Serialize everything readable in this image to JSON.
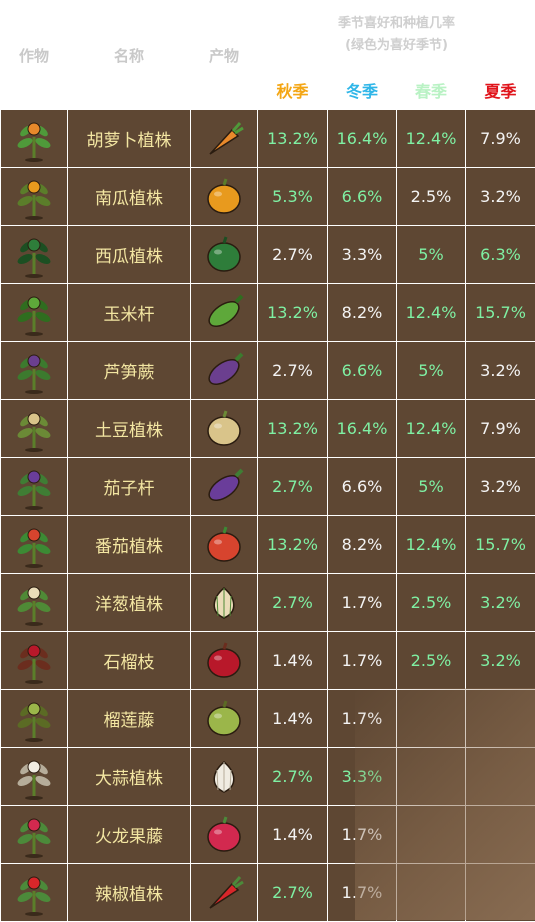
{
  "header": {
    "col_crop": "作物",
    "col_name": "名称",
    "col_product": "产物",
    "note_line1": "季节喜好和种植几率",
    "note_line2": "(绿色为喜好季节)",
    "seasons": [
      "秋季",
      "冬季",
      "春季",
      "夏季"
    ]
  },
  "colors": {
    "background": "#5e4733",
    "name_text": "#f3e6a2",
    "favored_value": "#7ff0a3",
    "normal_value": "#f4f4f4",
    "autumn": "#f4a614",
    "winter": "#2fb6e8",
    "spring": "#b9f2c4",
    "summer": "#e0141b"
  },
  "rows": [
    {
      "name": "胡萝卜植株",
      "crop_icon": "carrot-plant-icon",
      "product_icon": "carrot-icon",
      "values": [
        {
          "v": "13.2%",
          "fav": true
        },
        {
          "v": "16.4%",
          "fav": true
        },
        {
          "v": "12.4%",
          "fav": true
        },
        {
          "v": "7.9%",
          "fav": false
        }
      ]
    },
    {
      "name": "南瓜植株",
      "crop_icon": "pumpkin-plant-icon",
      "product_icon": "pumpkin-icon",
      "values": [
        {
          "v": "5.3%",
          "fav": true
        },
        {
          "v": "6.6%",
          "fav": true
        },
        {
          "v": "2.5%",
          "fav": false
        },
        {
          "v": "3.2%",
          "fav": false
        }
      ]
    },
    {
      "name": "西瓜植株",
      "crop_icon": "watermelon-plant-icon",
      "product_icon": "watermelon-icon",
      "values": [
        {
          "v": "2.7%",
          "fav": false
        },
        {
          "v": "3.3%",
          "fav": false
        },
        {
          "v": "5%",
          "fav": true
        },
        {
          "v": "6.3%",
          "fav": true
        }
      ]
    },
    {
      "name": "玉米杆",
      "crop_icon": "corn-plant-icon",
      "product_icon": "corn-icon",
      "values": [
        {
          "v": "13.2%",
          "fav": true
        },
        {
          "v": "8.2%",
          "fav": false
        },
        {
          "v": "12.4%",
          "fav": true
        },
        {
          "v": "15.7%",
          "fav": true
        }
      ]
    },
    {
      "name": "芦笋蕨",
      "crop_icon": "asparagus-plant-icon",
      "product_icon": "asparagus-icon",
      "values": [
        {
          "v": "2.7%",
          "fav": false
        },
        {
          "v": "6.6%",
          "fav": true
        },
        {
          "v": "5%",
          "fav": true
        },
        {
          "v": "3.2%",
          "fav": false
        }
      ]
    },
    {
      "name": "土豆植株",
      "crop_icon": "potato-plant-icon",
      "product_icon": "potato-icon",
      "values": [
        {
          "v": "13.2%",
          "fav": true
        },
        {
          "v": "16.4%",
          "fav": true
        },
        {
          "v": "12.4%",
          "fav": true
        },
        {
          "v": "7.9%",
          "fav": false
        }
      ]
    },
    {
      "name": "茄子杆",
      "crop_icon": "eggplant-plant-icon",
      "product_icon": "eggplant-icon",
      "values": [
        {
          "v": "2.7%",
          "fav": true
        },
        {
          "v": "6.6%",
          "fav": false
        },
        {
          "v": "5%",
          "fav": true
        },
        {
          "v": "3.2%",
          "fav": false
        }
      ]
    },
    {
      "name": "番茄植株",
      "crop_icon": "tomato-plant-icon",
      "product_icon": "tomato-icon",
      "values": [
        {
          "v": "13.2%",
          "fav": true
        },
        {
          "v": "8.2%",
          "fav": false
        },
        {
          "v": "12.4%",
          "fav": true
        },
        {
          "v": "15.7%",
          "fav": true
        }
      ]
    },
    {
      "name": "洋葱植株",
      "crop_icon": "onion-plant-icon",
      "product_icon": "onion-icon",
      "values": [
        {
          "v": "2.7%",
          "fav": true
        },
        {
          "v": "1.7%",
          "fav": false
        },
        {
          "v": "2.5%",
          "fav": true
        },
        {
          "v": "3.2%",
          "fav": true
        }
      ]
    },
    {
      "name": "石榴枝",
      "crop_icon": "pomegranate-plant-icon",
      "product_icon": "pomegranate-icon",
      "values": [
        {
          "v": "1.4%",
          "fav": false
        },
        {
          "v": "1.7%",
          "fav": false
        },
        {
          "v": "2.5%",
          "fav": true
        },
        {
          "v": "3.2%",
          "fav": true
        }
      ]
    },
    {
      "name": "榴莲藤",
      "crop_icon": "durian-plant-icon",
      "product_icon": "durian-icon",
      "values": [
        {
          "v": "1.4%",
          "fav": false
        },
        {
          "v": "1.7%",
          "fav": false
        },
        {
          "v": "",
          "fav": false
        },
        {
          "v": "",
          "fav": false
        }
      ]
    },
    {
      "name": "大蒜植株",
      "crop_icon": "garlic-plant-icon",
      "product_icon": "garlic-icon",
      "values": [
        {
          "v": "2.7%",
          "fav": true
        },
        {
          "v": "3.3%",
          "fav": true
        },
        {
          "v": "",
          "fav": false
        },
        {
          "v": "",
          "fav": false
        }
      ]
    },
    {
      "name": "火龙果藤",
      "crop_icon": "dragonfruit-plant-icon",
      "product_icon": "dragonfruit-icon",
      "values": [
        {
          "v": "1.4%",
          "fav": false
        },
        {
          "v": "1.7%",
          "fav": false
        },
        {
          "v": "",
          "fav": false
        },
        {
          "v": "",
          "fav": false
        }
      ]
    },
    {
      "name": "辣椒植株",
      "crop_icon": "pepper-plant-icon",
      "product_icon": "pepper-icon",
      "values": [
        {
          "v": "2.7%",
          "fav": true
        },
        {
          "v": "1.7%",
          "fav": false
        },
        {
          "v": "",
          "fav": false
        },
        {
          "v": "",
          "fav": false
        }
      ]
    }
  ]
}
